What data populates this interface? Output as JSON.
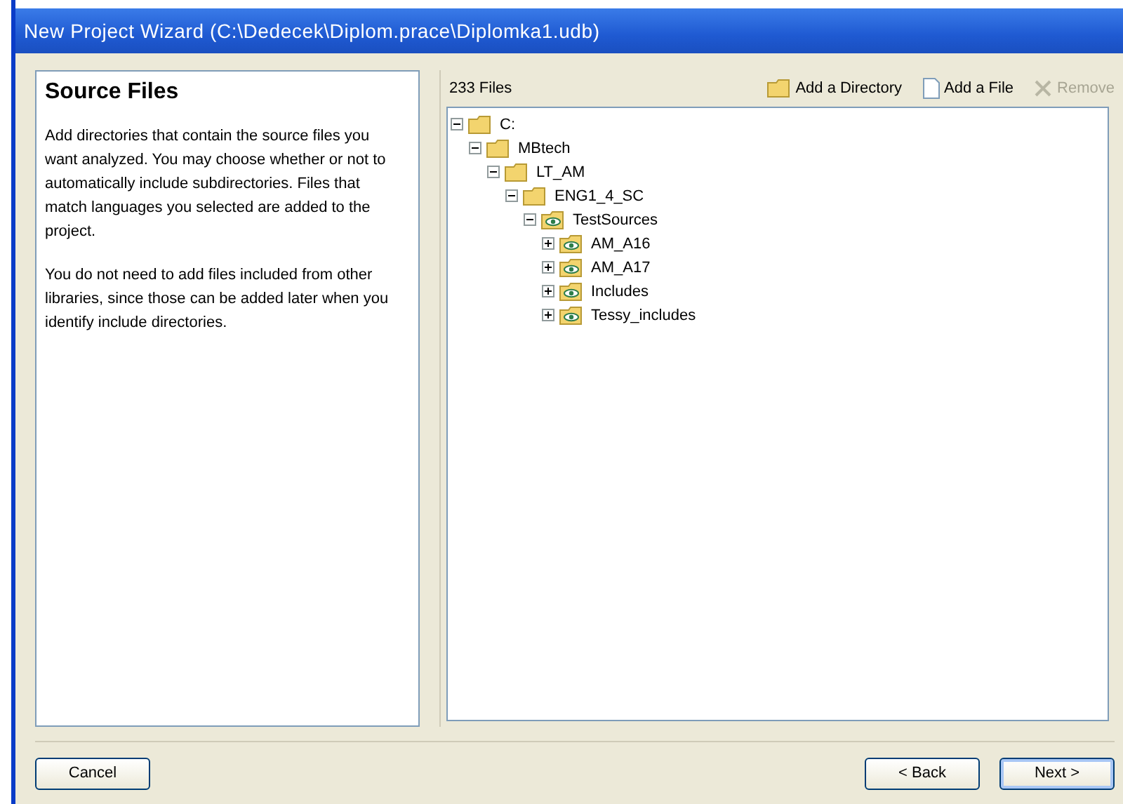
{
  "window": {
    "title": "New Project Wizard (C:\\Dedecek\\Diplom.prace\\Diplomka1.udb)"
  },
  "info": {
    "heading": "Source Files",
    "paragraphs": [
      "Add directories that contain the source files you want analyzed. You may choose whether or not to automatically include subdirectories. Files that match languages you selected are added to the project.",
      "You do not need to add files included from other libraries, since those can be added later when you identify include directories."
    ]
  },
  "files_count": "233 Files",
  "toolbar": [
    {
      "kind": "folder",
      "label": "Add a Directory",
      "disabled": false
    },
    {
      "kind": "file",
      "label": "Add a File",
      "disabled": false
    },
    {
      "kind": "remove",
      "label": "Remove",
      "disabled": true
    }
  ],
  "tree": [
    {
      "label": "C:",
      "kind": "folder",
      "expanded": true,
      "children": [
        {
          "label": "MBtech",
          "kind": "folder",
          "expanded": true,
          "children": [
            {
              "label": "LT_AM",
              "kind": "folder",
              "expanded": true,
              "children": [
                {
                  "label": "ENG1_4_SC",
                  "kind": "folder",
                  "expanded": true,
                  "children": [
                    {
                      "label": "TestSources",
                      "kind": "source",
                      "expanded": true,
                      "children": [
                        {
                          "label": "AM_A16",
                          "kind": "source",
                          "expanded": false
                        },
                        {
                          "label": "AM_A17",
                          "kind": "source",
                          "expanded": false
                        },
                        {
                          "label": "Includes",
                          "kind": "source",
                          "expanded": false
                        },
                        {
                          "label": "Tessy_includes",
                          "kind": "source",
                          "expanded": false
                        }
                      ]
                    }
                  ]
                }
              ]
            }
          ]
        }
      ]
    }
  ],
  "buttons": [
    {
      "label": "Cancel",
      "kind": "cancel"
    },
    {
      "label": "< Back",
      "kind": "back"
    },
    {
      "label": "Next >",
      "kind": "next"
    }
  ]
}
